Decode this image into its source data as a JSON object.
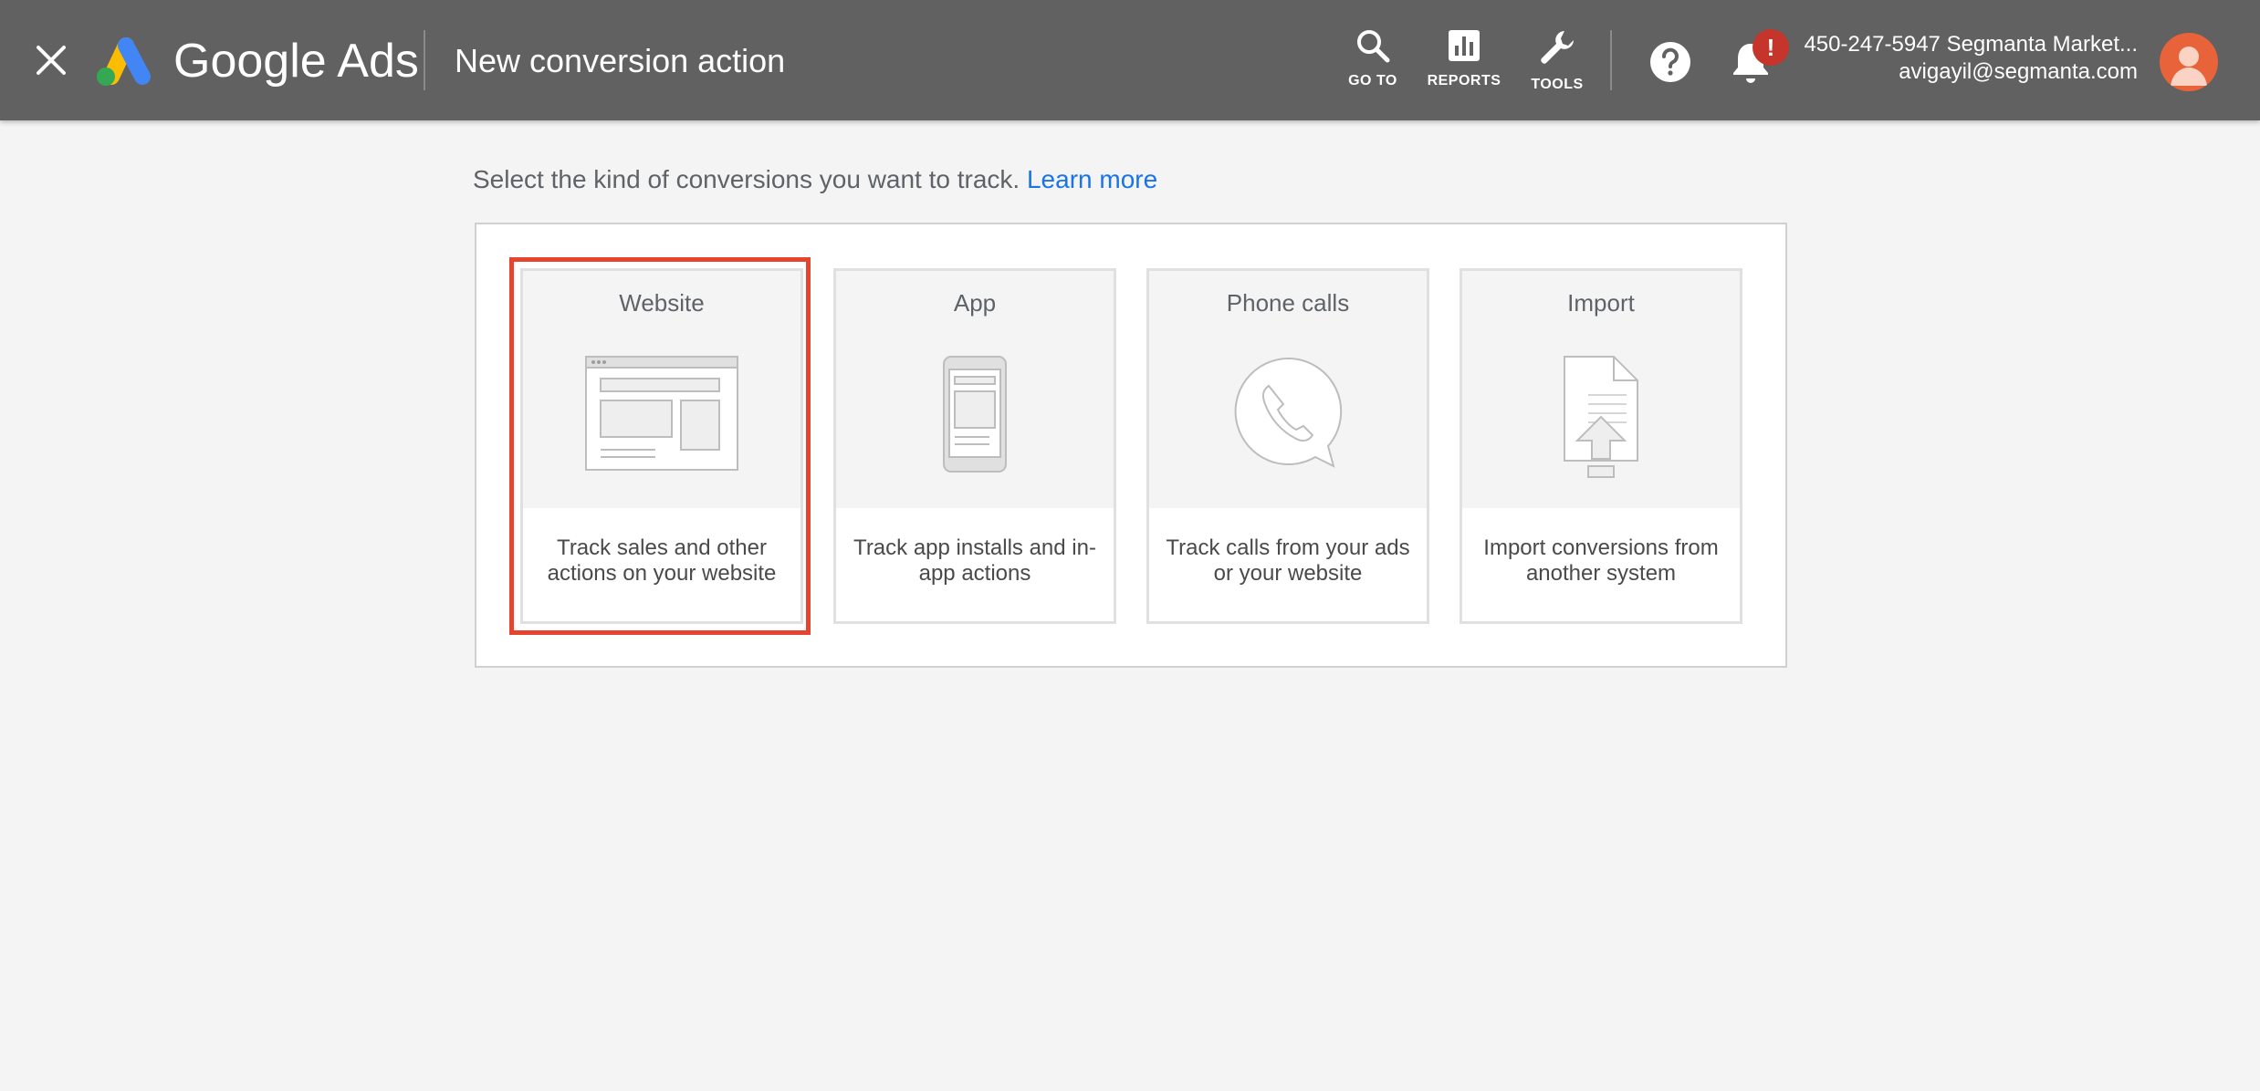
{
  "header": {
    "brand": "Google Ads",
    "page_title": "New conversion action",
    "nav": {
      "goto_label": "GO TO",
      "reports_label": "REPORTS",
      "tools_label": "TOOLS"
    },
    "alert_badge": "!",
    "account": {
      "name": "450-247-5947 Segmanta Market...",
      "email": "avigayil@segmanta.com"
    }
  },
  "intro": {
    "text": "Select the kind of conversions you want to track.",
    "link": "Learn more"
  },
  "cards": [
    {
      "title": "Website",
      "description": "Track sales and other actions on your website",
      "icon": "website-icon",
      "selected": true
    },
    {
      "title": "App",
      "description": "Track app installs and in-app actions",
      "icon": "phone-app-icon",
      "selected": false
    },
    {
      "title": "Phone calls",
      "description": "Track calls from your ads or your website",
      "icon": "phone-call-icon",
      "selected": false
    },
    {
      "title": "Import",
      "description": "Import conversions from another system",
      "icon": "import-icon",
      "selected": false
    }
  ],
  "colors": {
    "topbar": "#616161",
    "background": "#f4f4f4",
    "link": "#1a73e8",
    "selection": "#e5452e",
    "alert": "#c5352b",
    "avatar": "#e8633a"
  }
}
